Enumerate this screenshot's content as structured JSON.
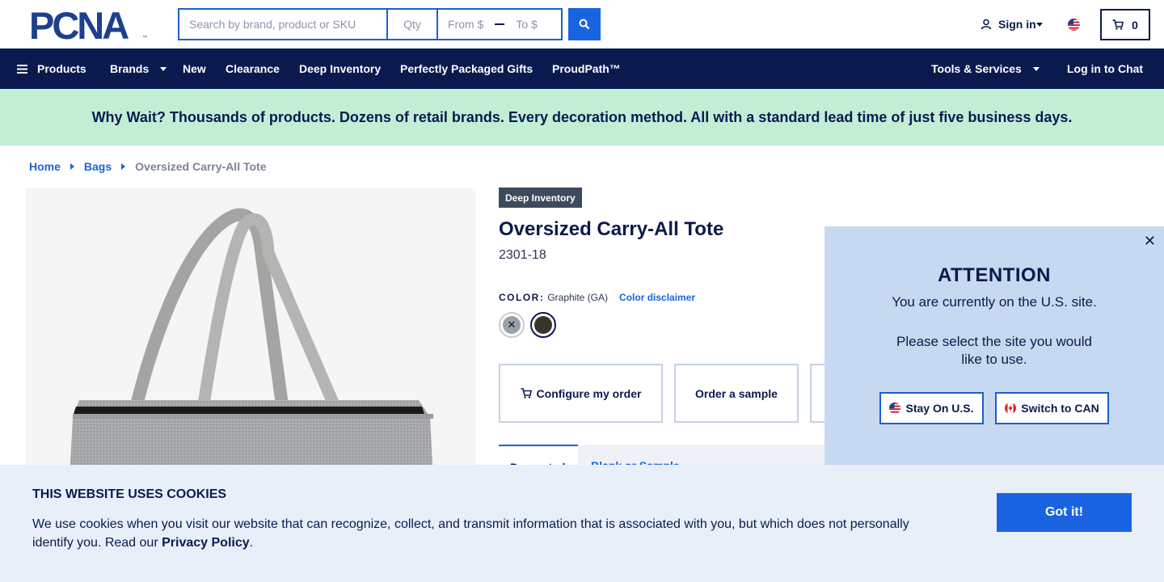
{
  "header": {
    "logo_text": "PCNA",
    "search_placeholder": "Search by brand, product or SKU",
    "qty_placeholder": "Qty",
    "price_from_placeholder": "From $",
    "price_to_placeholder": "To $",
    "sign_in_label": "Sign in",
    "cart_count": "0"
  },
  "nav": {
    "items": [
      {
        "label": "Products"
      },
      {
        "label": "Brands"
      },
      {
        "label": "New"
      },
      {
        "label": "Clearance"
      },
      {
        "label": "Deep Inventory"
      },
      {
        "label": "Perfectly Packaged Gifts"
      },
      {
        "label": "ProudPath™"
      },
      {
        "label": "Tools & Services"
      },
      {
        "label": "Log in to Chat"
      }
    ]
  },
  "promo": {
    "text": "Why Wait? Thousands of products. Dozens of retail brands. Every decoration method. All with a standard lead time of just five business days."
  },
  "breadcrumb": {
    "items": [
      "Home",
      "Bags",
      "Oversized Carry-All Tote"
    ]
  },
  "product": {
    "badge": "Deep Inventory",
    "title": "Oversized Carry-All Tote",
    "sku": "2301-18",
    "color_label": "COLOR:",
    "color_value": "Graphite (GA)",
    "color_disclaimer": "Color disclaimer",
    "configure_label": "Configure my order",
    "sample_label": "Order a sample",
    "tab_label_1": "Decorated",
    "tab_label_2": "Blank or Sample"
  },
  "modal": {
    "title": "ATTENTION",
    "line1": "You are currently on the U.S. site.",
    "line2": "Please select the site you would",
    "line3": "like to use.",
    "stay_label": "Stay On U.S.",
    "switch_label": "Switch to CAN"
  },
  "cookie": {
    "title": "THIS WEBSITE USES COOKIES",
    "text": "We use cookies when you visit our website that can recognize, collect, and transmit information that is associated with you, but which does not personally identify you. Read our",
    "link": "Privacy Policy",
    "period": ".",
    "button": "Got it!"
  },
  "colors": {
    "navy": "#0a1a4e",
    "accent_blue": "#1a63e0",
    "promo_bg": "#c3eed6",
    "modal_bg": "#c7d9f0",
    "cookie_bg": "#e8eff9"
  }
}
